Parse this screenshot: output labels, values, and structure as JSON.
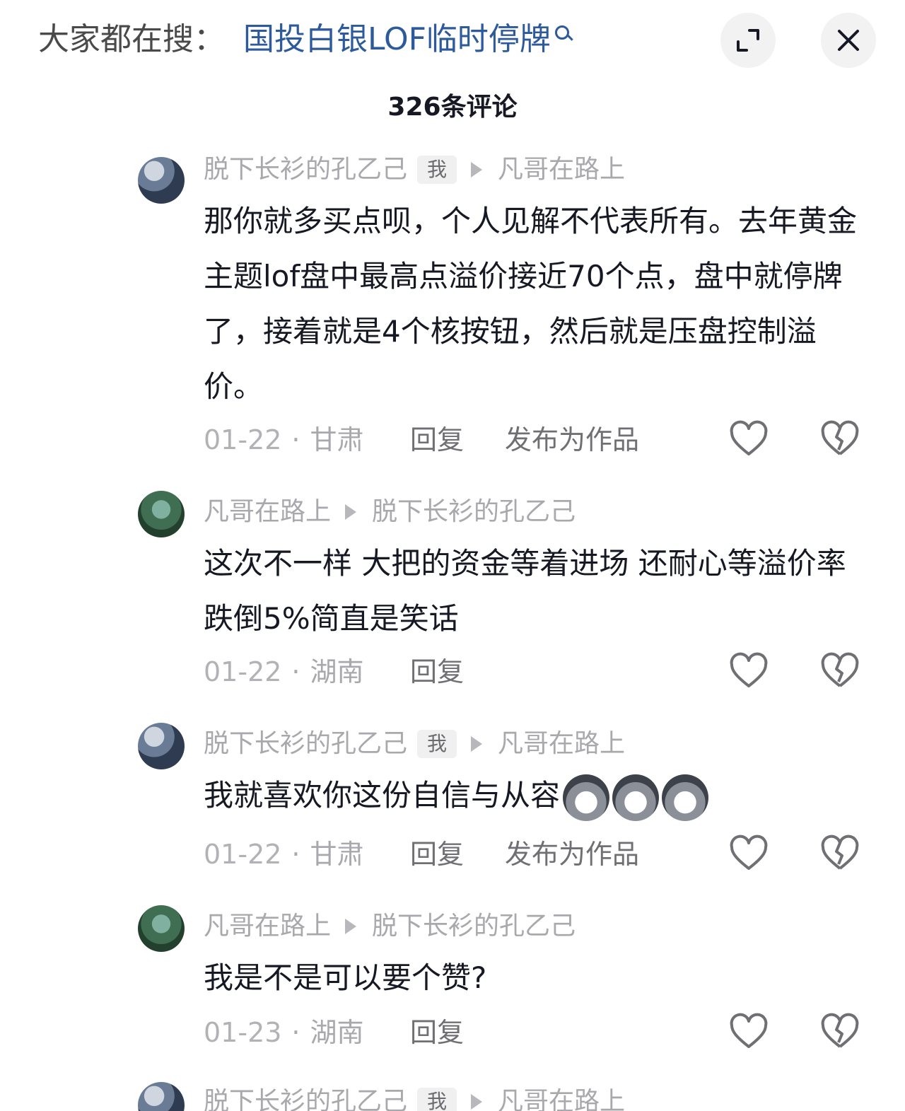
{
  "search_bar": {
    "prefix": "大家都在搜：",
    "query": "国投白银LOF临时停牌"
  },
  "comment_count": "326条评论",
  "replies": [
    {
      "author": "脱下长衫的孔乙己",
      "me_tag": "我",
      "reply_to": "凡哥在路上",
      "text": "那你就多买点呗，个人见解不代表所有。去年黄金主题lof盘中最高点溢价接近70个点，盘中就停牌了，接着就是4个核按钮，然后就是压盘控制溢价。",
      "date": "01-22",
      "location": "甘肃",
      "reply_label": "回复",
      "publish_label": "发布为作品"
    },
    {
      "author": "凡哥在路上",
      "reply_to": "脱下长衫的孔乙己",
      "text": "这次不一样 大把的资金等着进场 还耐心等溢价率跌倒5%简直是笑话",
      "date": "01-22",
      "location": "湖南",
      "reply_label": "回复"
    },
    {
      "author": "脱下长衫的孔乙己",
      "me_tag": "我",
      "reply_to": "凡哥在路上",
      "text": "我就喜欢你这份自信与从容",
      "date": "01-22",
      "location": "甘肃",
      "reply_label": "回复",
      "publish_label": "发布为作品"
    },
    {
      "author": "凡哥在路上",
      "reply_to": "脱下长衫的孔乙己",
      "text": "我是不是可以要个赞?",
      "date": "01-23",
      "location": "湖南",
      "reply_label": "回复"
    },
    {
      "author": "脱下长衫的孔乙己",
      "me_tag": "我",
      "reply_to": "凡哥在路上"
    }
  ],
  "colors": {
    "link": "#2c5a9b",
    "muted": "#a9a9ad",
    "text": "#161823"
  }
}
